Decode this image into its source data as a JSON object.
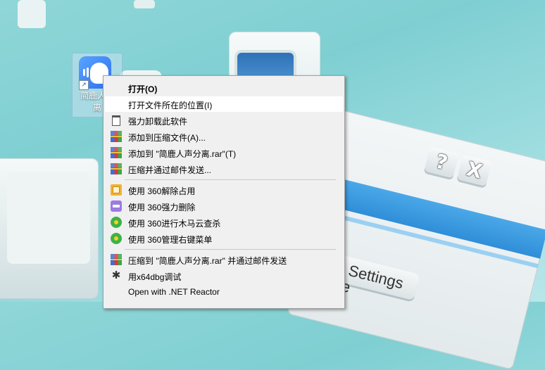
{
  "desktop": {
    "shortcut_label_line1": "简鹿人声",
    "shortcut_label_line2": "离",
    "dialog_help": "?",
    "dialog_close": "X",
    "dialog_settings": "Settings",
    "dialog_fragment": "e"
  },
  "context_menu": {
    "items": [
      {
        "label": "打开(O)",
        "icon": "none"
      },
      {
        "label": "打开文件所在的位置(I)",
        "icon": "none"
      },
      {
        "label": "强力卸载此软件",
        "icon": "trash-icon"
      },
      {
        "label": "添加到压缩文件(A)...",
        "icon": "winrar-icon"
      },
      {
        "label": "添加到 \"简鹿人声分离.rar\"(T)",
        "icon": "winrar-icon"
      },
      {
        "label": "压缩并通过邮件发送...",
        "icon": "winrar-icon"
      },
      {
        "label": "使用 360解除占用",
        "icon": "unlock-icon"
      },
      {
        "label": "使用 360强力删除",
        "icon": "shred-icon"
      },
      {
        "label": "使用 360进行木马云查杀",
        "icon": "360-icon"
      },
      {
        "label": "使用 360管理右键菜单",
        "icon": "360-icon"
      },
      {
        "label": "压缩到 \"简鹿人声分离.rar\" 并通过邮件发送",
        "icon": "winrar-icon"
      },
      {
        "label": "用x64dbg调试",
        "icon": "bug-icon"
      },
      {
        "label": "Open with .NET Reactor",
        "icon": "none"
      }
    ]
  }
}
